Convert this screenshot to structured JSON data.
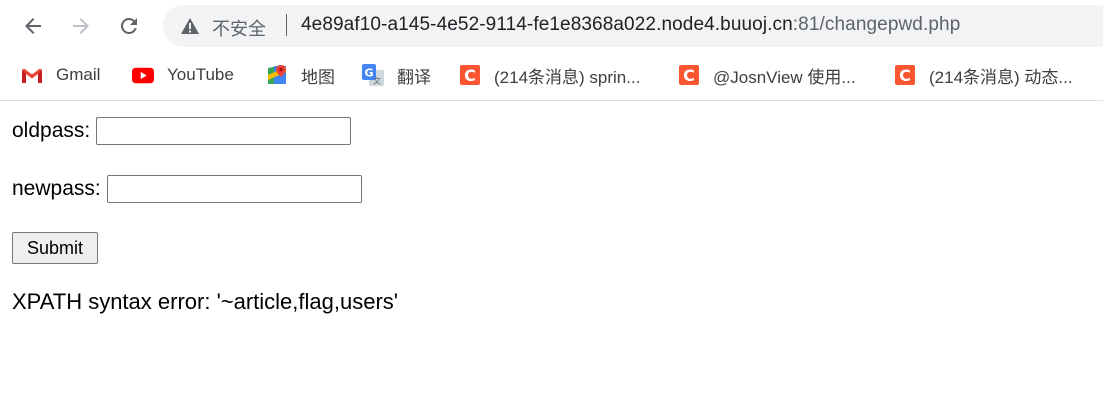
{
  "browser": {
    "security_label": "不安全",
    "url_host": "4e89af10-a145-4e52-9114-fe1e8368a022.node4.buuoj.cn",
    "url_rest": ":81/changepwd.php"
  },
  "bookmarks": [
    {
      "label": "Gmail",
      "icon": "gmail-icon"
    },
    {
      "label": "YouTube",
      "icon": "youtube-icon"
    },
    {
      "label": "地图",
      "icon": "maps-icon"
    },
    {
      "label": "翻译",
      "icon": "translate-icon"
    },
    {
      "label": "(214条消息) sprin...",
      "icon": "csdn-icon"
    },
    {
      "label": "@JosnView 使用...",
      "icon": "csdn-icon"
    },
    {
      "label": "(214条消息) 动态...",
      "icon": "csdn-icon"
    }
  ],
  "form": {
    "oldpass_label": "oldpass:",
    "oldpass_value": "",
    "newpass_label": "newpass:",
    "newpass_value": "",
    "submit_label": "Submit"
  },
  "error_message": "XPATH syntax error: '~article,flag,users'",
  "colors": {
    "csdn": "#fc5531",
    "youtube": "#ff0000",
    "omnibox_bg": "#f1f3f4"
  }
}
